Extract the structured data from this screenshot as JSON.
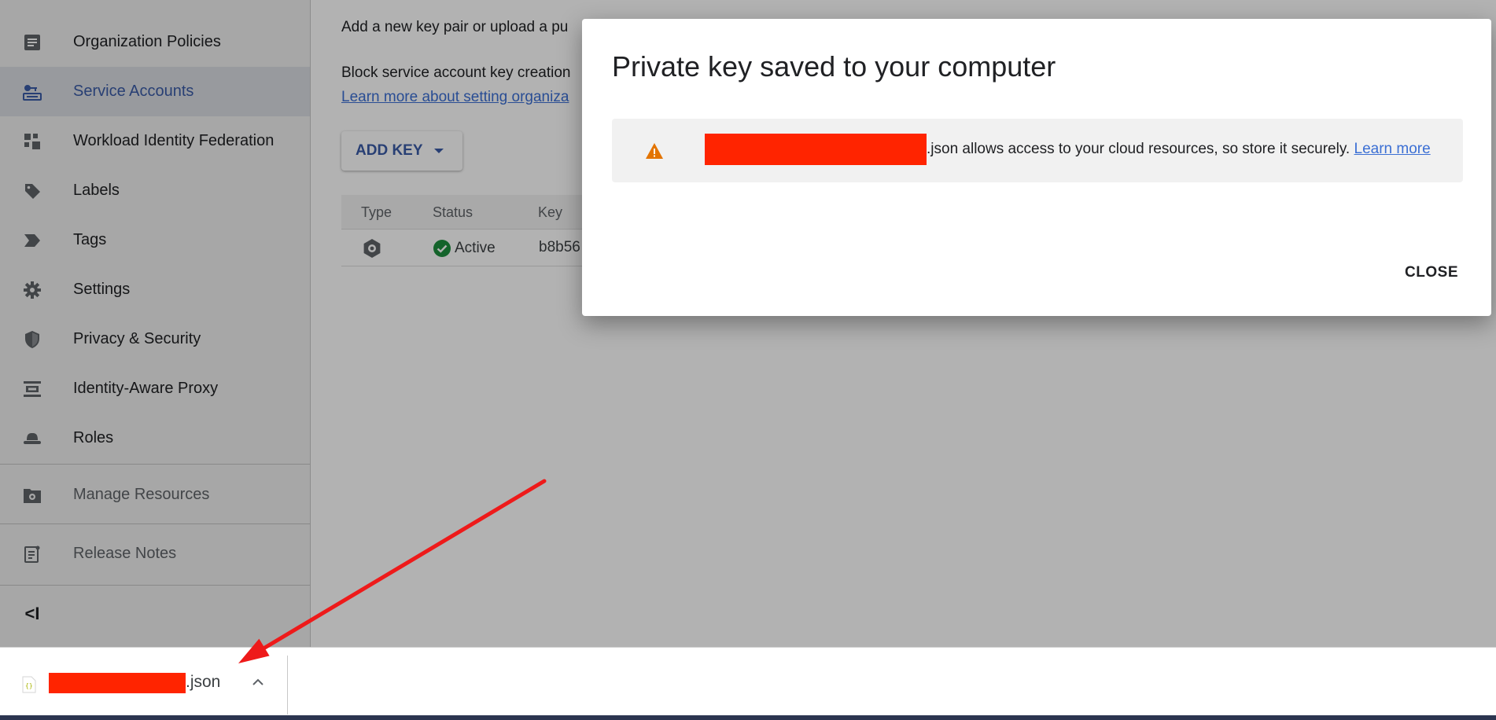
{
  "sidebar": {
    "items": [
      {
        "label": "Organization Policies",
        "icon": "policy-document-icon"
      },
      {
        "label": "Service Accounts",
        "icon": "service-account-icon",
        "active": true
      },
      {
        "label": "Workload Identity Federation",
        "icon": "workload-identity-icon"
      },
      {
        "label": "Labels",
        "icon": "label-icon"
      },
      {
        "label": "Tags",
        "icon": "tag-icon"
      },
      {
        "label": "Settings",
        "icon": "gear-icon"
      },
      {
        "label": "Privacy & Security",
        "icon": "shield-icon"
      },
      {
        "label": "Identity-Aware Proxy",
        "icon": "proxy-icon"
      },
      {
        "label": "Roles",
        "icon": "hat-icon"
      }
    ],
    "footer_items": [
      {
        "label": "Manage Resources",
        "icon": "folder-gear-icon"
      },
      {
        "label": "Release Notes",
        "icon": "release-notes-icon"
      }
    ],
    "collapse_label": "<I"
  },
  "main": {
    "description_line1": "Add a new key pair or upload a pu",
    "description_line2": "Block service account key creation",
    "learn_more_link": "Learn more about setting organiza",
    "add_key_label": "ADD KEY",
    "table": {
      "headers": [
        "Type",
        "Status",
        "Key"
      ],
      "rows": [
        {
          "type_icon": "key-type-icon",
          "status": "Active",
          "key": "b8b56"
        }
      ]
    }
  },
  "dialog": {
    "title": "Private key saved to your computer",
    "warning_text": ".json allows access to your cloud resources, so store it securely.",
    "warning_link": "Learn more",
    "close_label": "CLOSE"
  },
  "download_bar": {
    "file_suffix": ".json"
  },
  "colors": {
    "accent_blue": "#3a5ba6",
    "link_blue": "#3b6fd4",
    "redaction_red": "#ff2400",
    "warning_orange": "#e37400",
    "success_green": "#1e8e3e",
    "annotation_arrow": "#ee1a1a"
  }
}
